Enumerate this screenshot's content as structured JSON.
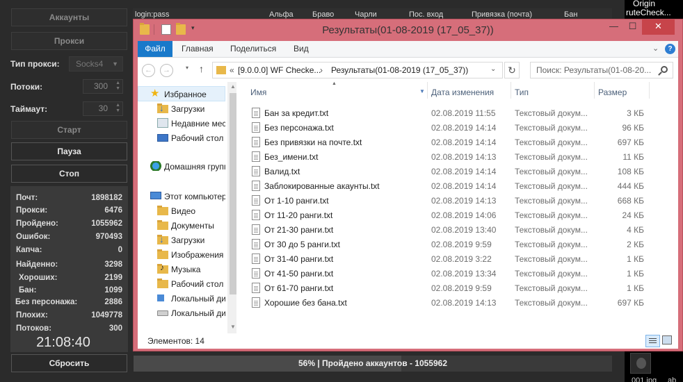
{
  "checker": {
    "btn_accounts": "Аккаунты",
    "btn_proxies": "Прокси",
    "proxy_type_label": "Тип прокси:",
    "proxy_type_value": "Socks4",
    "threads_label": "Потоки:",
    "threads_value": "300",
    "timeout_label": "Таймаут:",
    "timeout_value": "30",
    "btn_start": "Старт",
    "btn_pause": "Пауза",
    "btn_stop": "Стоп",
    "stats": [
      {
        "label": "Почт:",
        "value": "1898182"
      },
      {
        "label": "Прокси:",
        "value": "6476"
      },
      {
        "label": "Пройдено:",
        "value": "1055962"
      },
      {
        "label": "Ошибок:",
        "value": "970493"
      },
      {
        "label": "Капча:",
        "value": "0"
      },
      {
        "label": "Найденно:",
        "value": "3298"
      },
      {
        "label": "Хороших:",
        "value": "2199"
      },
      {
        "label": "Бан:",
        "value": "1099"
      },
      {
        "label": "Без персонажа:",
        "value": "2886"
      },
      {
        "label": "Плохих:",
        "value": "1049778"
      },
      {
        "label": "Потоков:",
        "value": "300"
      }
    ],
    "clock": "21:08:40",
    "btn_reset": "Сбросить",
    "table_headers": [
      "login:pass",
      "Альфа",
      "Браво",
      "Чарли",
      "Пос. вход",
      "Привязка (почта)",
      "Бан"
    ],
    "progress_fraction": 0.56,
    "progress_text": "56% | Пройдено аккаунтов - 1055962"
  },
  "right_window": {
    "title_line1": "Origin",
    "title_line2": "ruteCheck...",
    "footer_left": "001.jpg",
    "footer_right": "ab"
  },
  "explorer": {
    "title": "Результаты(01-08-2019 (17_05_37))",
    "ribbon_tabs": [
      "Файл",
      "Главная",
      "Поделиться",
      "Вид"
    ],
    "address_crumbs": [
      "«",
      "[9.0.0.0] WF Checke...",
      "›",
      "Результаты(01-08-2019 (17_05_37))"
    ],
    "search_placeholder": "Поиск: Результаты(01-08-20...",
    "nav_items": [
      {
        "label": "Избранное",
        "icon": "star-icon"
      },
      {
        "label": "Загрузки",
        "icon": "downloads-folder-icon"
      },
      {
        "label": "Недавние места",
        "icon": "recent-places-icon"
      },
      {
        "label": "Рабочий стол",
        "icon": "desktop-icon"
      },
      {
        "label": "Домашняя группа",
        "icon": "homegroup-icon"
      },
      {
        "label": "Этот компьютер",
        "icon": "computer-icon"
      },
      {
        "label": "Видео",
        "icon": "folder-icon"
      },
      {
        "label": "Документы",
        "icon": "folder-icon"
      },
      {
        "label": "Загрузки",
        "icon": "downloads-folder-icon"
      },
      {
        "label": "Изображения",
        "icon": "folder-icon"
      },
      {
        "label": "Музыка",
        "icon": "music-folder-icon"
      },
      {
        "label": "Рабочий стол",
        "icon": "folder-icon"
      },
      {
        "label": "Локальный диск",
        "icon": "windows-drive-icon"
      },
      {
        "label": "Локальный диск",
        "icon": "drive-icon"
      }
    ],
    "columns": [
      "Имя",
      "Дата изменения",
      "Тип",
      "Размер"
    ],
    "files": [
      {
        "name": "Бан за кредит.txt",
        "date": "02.08.2019 11:55",
        "type": "Текстовый докум...",
        "size": "3 КБ"
      },
      {
        "name": "Без персонажа.txt",
        "date": "02.08.2019 14:14",
        "type": "Текстовый докум...",
        "size": "96 КБ"
      },
      {
        "name": "Без привязки на почте.txt",
        "date": "02.08.2019 14:14",
        "type": "Текстовый докум...",
        "size": "697 КБ"
      },
      {
        "name": "Без_имени.txt",
        "date": "02.08.2019 14:13",
        "type": "Текстовый докум...",
        "size": "11 КБ"
      },
      {
        "name": "Валид.txt",
        "date": "02.08.2019 14:14",
        "type": "Текстовый докум...",
        "size": "108 КБ"
      },
      {
        "name": "Заблокированные акаунты.txt",
        "date": "02.08.2019 14:14",
        "type": "Текстовый докум...",
        "size": "444 КБ"
      },
      {
        "name": "От 1-10 ранги.txt",
        "date": "02.08.2019 14:13",
        "type": "Текстовый докум...",
        "size": "668 КБ"
      },
      {
        "name": "От 11-20 ранги.txt",
        "date": "02.08.2019 14:06",
        "type": "Текстовый докум...",
        "size": "24 КБ"
      },
      {
        "name": "От 21-30 ранги.txt",
        "date": "02.08.2019 13:40",
        "type": "Текстовый докум...",
        "size": "4 КБ"
      },
      {
        "name": "От 30 до 5 ранги.txt",
        "date": "02.08.2019 9:59",
        "type": "Текстовый докум...",
        "size": "2 КБ"
      },
      {
        "name": "От 31-40 ранги.txt",
        "date": "02.08.2019 3:22",
        "type": "Текстовый докум...",
        "size": "1 КБ"
      },
      {
        "name": "От 41-50 ранги.txt",
        "date": "02.08.2019 13:34",
        "type": "Текстовый докум...",
        "size": "1 КБ"
      },
      {
        "name": "От 61-70 ранги.txt",
        "date": "02.08.2019 9:59",
        "type": "Текстовый докум...",
        "size": "1 КБ"
      },
      {
        "name": "Хорошие без бана.txt",
        "date": "02.08.2019 14:13",
        "type": "Текстовый докум...",
        "size": "697 КБ"
      }
    ],
    "status_text": "Элементов: 14"
  }
}
